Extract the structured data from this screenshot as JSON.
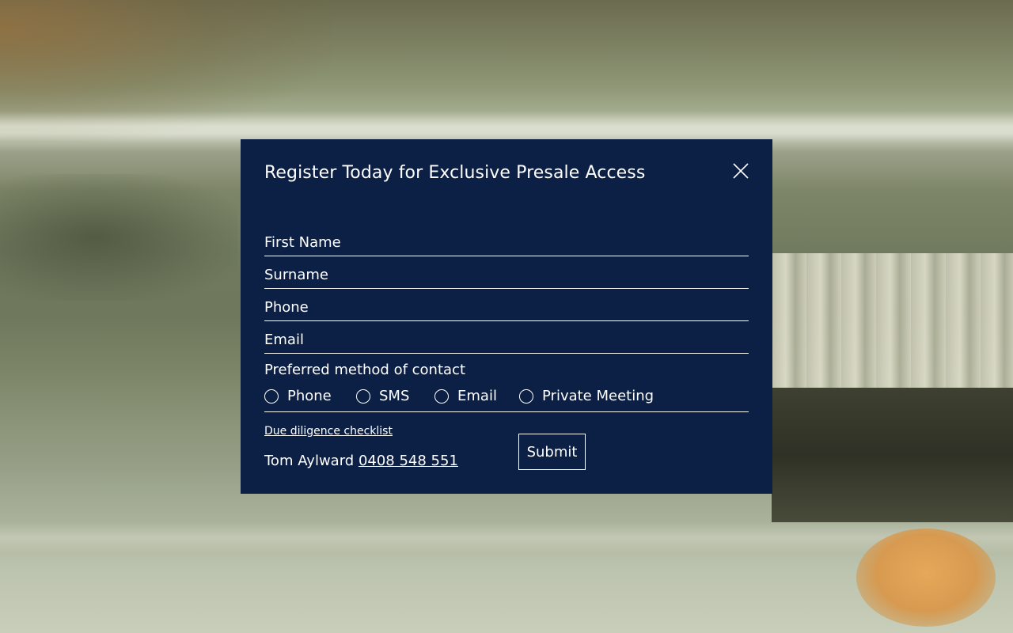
{
  "modal": {
    "title": "Register Today for Exclusive Presale Access",
    "close_icon": "close-icon",
    "background_color": "#0c1f44",
    "fields": {
      "first_name": {
        "placeholder": "First Name",
        "value": ""
      },
      "surname": {
        "placeholder": "Surname",
        "value": ""
      },
      "phone": {
        "placeholder": "Phone",
        "value": ""
      },
      "email": {
        "placeholder": "Email",
        "value": ""
      }
    },
    "contact": {
      "label": "Preferred method of contact",
      "options": [
        "Phone",
        "SMS",
        "Email",
        "Private Meeting"
      ],
      "selected": null
    },
    "checklist_link": "Due diligence checklist",
    "agent": {
      "name": "Tom Aylward",
      "phone": "0408 548 551"
    },
    "submit_label": "Submit"
  }
}
